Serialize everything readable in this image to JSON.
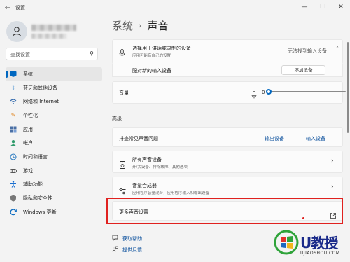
{
  "window": {
    "title": "设置",
    "back_glyph": "←",
    "minimize": "—",
    "maximize": "☐",
    "close": "✕"
  },
  "search": {
    "placeholder": "查找设置",
    "icon": "search-icon"
  },
  "sidebar": {
    "items": [
      {
        "label": "系统",
        "icon": "monitor-icon",
        "selected": true,
        "color": "#0067c0"
      },
      {
        "label": "蓝牙和其他设备",
        "icon": "bluetooth-icon",
        "color": "#0067c0"
      },
      {
        "label": "网络和 Internet",
        "icon": "wifi-icon",
        "color": "#3a6fb0"
      },
      {
        "label": "个性化",
        "icon": "brush-icon",
        "color": "#e08a2a"
      },
      {
        "label": "应用",
        "icon": "apps-icon",
        "color": "#4a6fa5"
      },
      {
        "label": "帐户",
        "icon": "account-icon",
        "color": "#2d9a6a"
      },
      {
        "label": "时间和语言",
        "icon": "globe-clock-icon",
        "color": "#2a7ac0"
      },
      {
        "label": "游戏",
        "icon": "game-icon",
        "color": "#555555"
      },
      {
        "label": "辅助功能",
        "icon": "accessibility-icon",
        "color": "#1a6fd0"
      },
      {
        "label": "隐私和安全性",
        "icon": "shield-icon",
        "color": "#666666"
      },
      {
        "label": "Windows 更新",
        "icon": "update-icon",
        "color": "#0a6ac0"
      }
    ]
  },
  "breadcrumb": {
    "parent": "系统",
    "separator": "›",
    "current": "声音"
  },
  "input": {
    "choose_label": "选择用于讲话或录制的设备",
    "choose_sub": "应用可能有自己的设置",
    "no_device": "无法找到输入设备",
    "pair_label": "配对新的输入设备",
    "add_button": "添加设备",
    "volume_label": "音量",
    "volume_value": "0",
    "volume_level": 0
  },
  "advanced": {
    "heading": "高级",
    "troubleshoot_label": "排查常见声音问题",
    "output_link": "输出设备",
    "input_link": "输入设备",
    "all_devices_label": "所有声音设备",
    "all_devices_sub": "开/关设备、排除故障、其他选项",
    "mixer_label": "音量合成器",
    "mixer_sub": "应用程序音量混合，应用程序输入和输出设备",
    "more_settings_label": "更多声音设置"
  },
  "help": {
    "get_help": "获取帮助",
    "feedback": "提供反馈"
  },
  "watermark": {
    "brand": "U教授",
    "url": "UJIAOSHOU.COM"
  },
  "colors": {
    "accent": "#0067c0",
    "highlight_red": "#e0211f"
  }
}
